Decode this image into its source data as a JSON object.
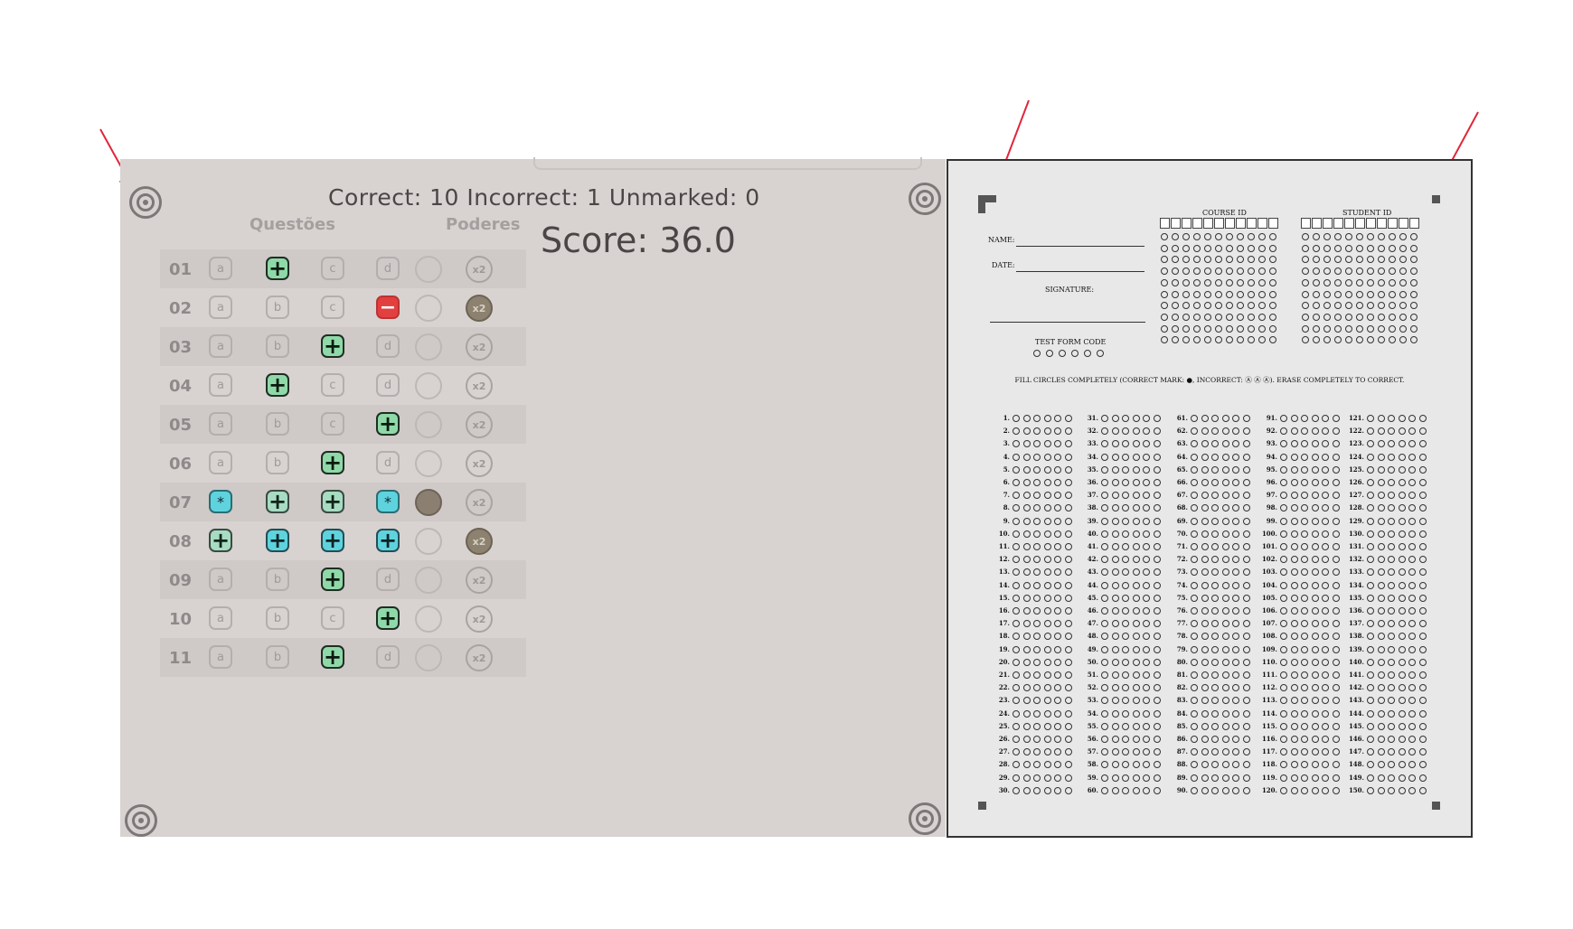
{
  "summary": {
    "correct_label": "Correct:",
    "correct": "10",
    "incorrect_label": "Incorrect:",
    "incorrect": "1",
    "unmarked_label": "Unmarked:",
    "unmarked": "0",
    "score_label": "Score:",
    "score": "36.0"
  },
  "headers": {
    "questions": "Questões",
    "powers": "Poderes"
  },
  "rows": [
    {
      "num": "01",
      "cells": [
        "a",
        "plus",
        "c",
        "d"
      ],
      "p1": "empty",
      "p2": "x2"
    },
    {
      "num": "02",
      "cells": [
        "a",
        "b",
        "c",
        "minus"
      ],
      "p1": "empty",
      "p2": "x2-dark"
    },
    {
      "num": "03",
      "cells": [
        "a",
        "b",
        "plus",
        "d"
      ],
      "p1": "empty",
      "p2": "x2"
    },
    {
      "num": "04",
      "cells": [
        "a",
        "plus",
        "c",
        "d"
      ],
      "p1": "empty",
      "p2": "x2"
    },
    {
      "num": "05",
      "cells": [
        "a",
        "b",
        "c",
        "plus"
      ],
      "p1": "empty",
      "p2": "x2"
    },
    {
      "num": "06",
      "cells": [
        "a",
        "b",
        "plus",
        "d"
      ],
      "p1": "empty",
      "p2": "x2"
    },
    {
      "num": "07",
      "cells": [
        "star",
        "plus-m",
        "plus-m",
        "star"
      ],
      "p1": "dark",
      "p2": "x2"
    },
    {
      "num": "08",
      "cells": [
        "plus-m",
        "plus-b",
        "plus-b",
        "plus-b"
      ],
      "p1": "empty",
      "p2": "x2-dark"
    },
    {
      "num": "09",
      "cells": [
        "a",
        "b",
        "plus",
        "d"
      ],
      "p1": "empty",
      "p2": "x2"
    },
    {
      "num": "10",
      "cells": [
        "a",
        "b",
        "c",
        "plus"
      ],
      "p1": "empty",
      "p2": "x2"
    },
    {
      "num": "11",
      "cells": [
        "a",
        "b",
        "plus",
        "d"
      ],
      "p1": "empty",
      "p2": "x2"
    }
  ],
  "sheet": {
    "course_id": "COURSE ID",
    "student_id": "STUDENT ID",
    "name": "NAME:",
    "date": "DATE:",
    "signature": "SIGNATURE:",
    "test_form_code": "TEST FORM CODE",
    "instructions": "FILL CIRCLES COMPLETELY (CORRECT MARK: ●, INCORRECT: Ⓐ Ⓐ Ⓐ). ERASE COMPLETELY TO CORRECT.",
    "question_count": 150
  },
  "colors": {
    "correct": "#8fd9a8",
    "incorrect": "#e2403f",
    "multi": "#5fd3dd",
    "arrow": "#e0263a"
  }
}
